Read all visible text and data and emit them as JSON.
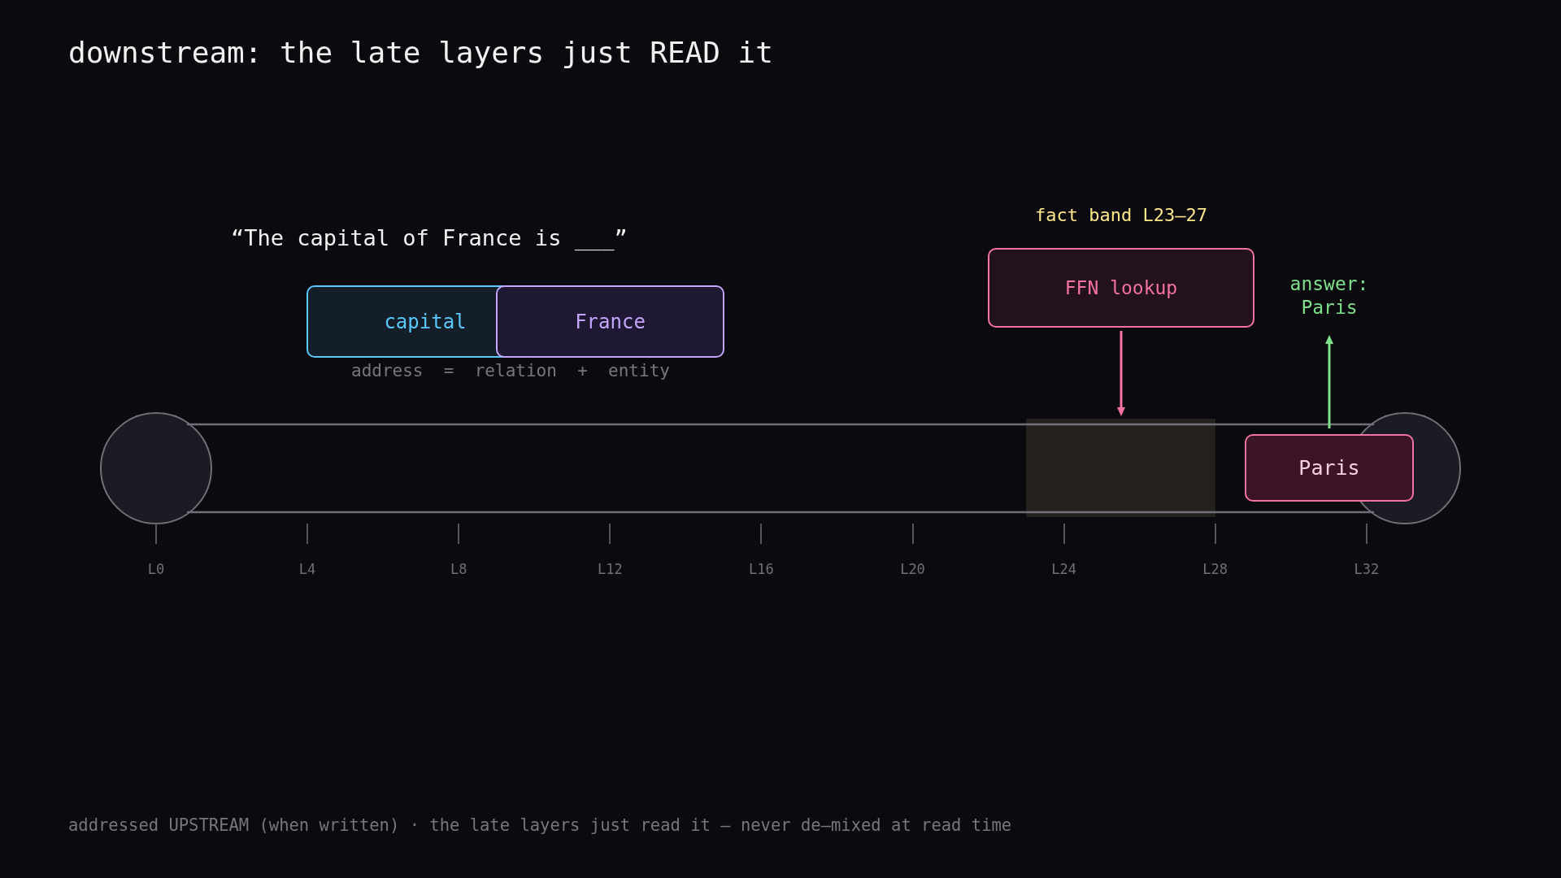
{
  "title": "downstream: the late layers just READ it",
  "prompt": "“The capital of France is ___”",
  "tokens": [
    {
      "label": "capital",
      "color": "#5ac8fa"
    },
    {
      "label": "France",
      "color": "#c4a5fb"
    }
  ],
  "address_formula": "address  =  relation  +  entity",
  "fact_band": {
    "label": "fact band L23–27",
    "lookup": "FFN lookup"
  },
  "answer": {
    "lines": [
      "answer:",
      "Paris"
    ],
    "token": "Paris"
  },
  "layer_axis": [
    "L0",
    "L4",
    "L8",
    "L12",
    "L16",
    "L20",
    "L24",
    "L28",
    "L32"
  ],
  "footer": "addressed UPSTREAM (when written) · the late layers just read it — never de–mixed at read time"
}
